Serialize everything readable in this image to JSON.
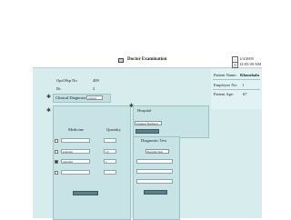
{
  "window": {
    "title": "Doctor Examination",
    "date": "1/4/2005",
    "time": "12:05:09 AM"
  },
  "patient": {
    "name_label": "Patient Name:",
    "name_value": "Khoushalu",
    "employee_label": "Employee No:",
    "employee_value": "1",
    "age_label": "Patient Age:",
    "age_value": "67"
  },
  "opd": {
    "hsp_label": "Opd Hsp No",
    "hsp_value": "409",
    "dr_label": "Dr.",
    "dr_value": "2"
  },
  "diagnosis": {
    "label": "Clinical Diagnosis",
    "selected": "cancer"
  },
  "medicine": {
    "col_medicine": "Medicine",
    "col_quantity": "Quantity",
    "rows": [
      {
        "name": "",
        "qty": ""
      },
      {
        "name": "ponstan",
        "qty": "12"
      },
      {
        "name": "panadol",
        "qty": "1"
      },
      {
        "name": "",
        "qty": ""
      }
    ]
  },
  "hospital": {
    "label": "Hospital",
    "selected": "Liaquat National"
  },
  "diagnostic": {
    "label": "Diagnostic Test",
    "selected": "Keratin Test"
  }
}
